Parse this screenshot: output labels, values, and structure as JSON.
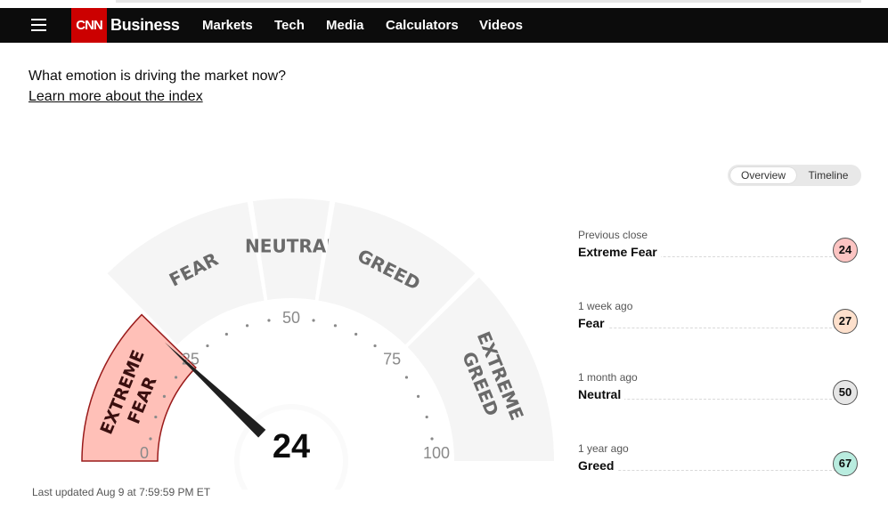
{
  "nav": {
    "logo": "CNN",
    "brand": "Business",
    "links": [
      "Markets",
      "Tech",
      "Media",
      "Calculators",
      "Videos"
    ]
  },
  "intro": {
    "question": "What emotion is driving the market now?",
    "learn_more": "Learn more about the index"
  },
  "toggle": {
    "overview": "Overview",
    "timeline": "Timeline",
    "selected": "Overview"
  },
  "gauge": {
    "value": 24,
    "value_text": "24",
    "segments": [
      {
        "label": "EXTREME FEAR",
        "lines": [
          "EXTREME",
          "FEAR"
        ],
        "active": true
      },
      {
        "label": "FEAR",
        "lines": [
          "FEAR"
        ],
        "active": false
      },
      {
        "label": "NEUTRAL",
        "lines": [
          "NEUTRAL"
        ],
        "active": false
      },
      {
        "label": "GREED",
        "lines": [
          "GREED"
        ],
        "active": false
      },
      {
        "label": "EXTREME GREED",
        "lines": [
          "EXTREME",
          "GREED"
        ],
        "active": false
      }
    ],
    "scale_labels": [
      "0",
      "25",
      "50",
      "75",
      "100"
    ],
    "last_updated": "Last updated Aug 9 at 7:59:59 PM ET",
    "colors": {
      "inactive": "#f5f5f5",
      "active_fill": "#ffc0b8",
      "active_stroke": "#9a1b1b",
      "needle": "#1f1f1f"
    }
  },
  "history": [
    {
      "period": "Previous close",
      "rating": "Extreme Fear",
      "value": "24",
      "color": "#fcc4c2"
    },
    {
      "period": "1 week ago",
      "rating": "Fear",
      "value": "27",
      "color": "#fde0cc"
    },
    {
      "period": "1 month ago",
      "rating": "Neutral",
      "value": "50",
      "color": "#e6e6e6"
    },
    {
      "period": "1 year ago",
      "rating": "Greed",
      "value": "67",
      "color": "#b9ecdf"
    }
  ]
}
